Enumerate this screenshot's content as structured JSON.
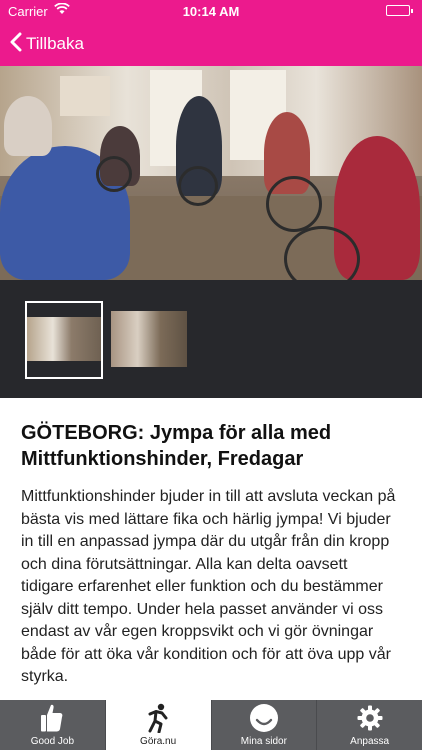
{
  "status_bar": {
    "carrier": "Carrier",
    "time": "10:14 AM",
    "battery_level": 1.0
  },
  "nav": {
    "back_label": "Tillbaka"
  },
  "gallery": {
    "image_count": 2,
    "selected_index": 0
  },
  "event": {
    "title": "GÖTEBORG: Jympa för alla med Mittfunktionshinder, Fredagar",
    "description": "Mittfunktionshinder bjuder in till att avsluta veckan på bästa vis med lättare fika och härlig jympa! Vi bjuder in till en anpassad jympa där du utgår från din kropp och dina förutsättningar. Alla kan delta oavsett tidigare erfarenhet eller funktion och du bestämmer själv ditt tempo. Under hela passet använder vi oss endast av vår egen kroppsvikt och vi gör övningar både för att öka vår kondition och för att öva upp vår styrka."
  },
  "tabs": [
    {
      "label": "Good Job",
      "icon": "thumbs-up-icon",
      "active": false
    },
    {
      "label": "Göra.nu",
      "icon": "running-person-icon",
      "active": true
    },
    {
      "label": "Mina sidor",
      "icon": "smiley-face-icon",
      "active": false
    },
    {
      "label": "Anpassa",
      "icon": "gear-icon",
      "active": false
    }
  ],
  "colors": {
    "brand": "#ec1a8d",
    "tab_bar": "#5b5c5f",
    "thumb_strip": "#27282c"
  }
}
